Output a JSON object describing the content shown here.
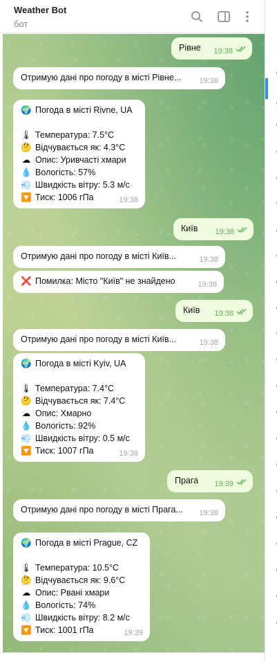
{
  "header": {
    "title": "Weather Bot",
    "subtitle": "бот"
  },
  "messages": {
    "m1": {
      "text": "Рівне",
      "time": "19:38"
    },
    "m2": {
      "text": "Отримую дані про погоду в місті Рівне...",
      "time": "19:38"
    },
    "m3": {
      "title": "Погода в місті Rivne, UA",
      "temp": "Температура: 7.5°C",
      "feels": "Відчувається як: 4.3°C",
      "desc": "Опис: Уривчасті хмари",
      "hum": "Вологість: 57%",
      "wind": "Швидкість вітру: 5.3 м/с",
      "press": "Тиск: 1006 гПа",
      "time": "19:38"
    },
    "m4": {
      "text": "Київ",
      "time": "19:38"
    },
    "m5": {
      "text": "Отримую дані про погоду в місті Київ...",
      "time": "19:38"
    },
    "m6": {
      "text": "Помилка: Місто \"Київ\" не знайдено",
      "time": "19:38"
    },
    "m7": {
      "text": "Київ",
      "time": "19:38"
    },
    "m8": {
      "text": "Отримую дані про погоду в місті Київ...",
      "time": "19:38"
    },
    "m9": {
      "title": "Погода в місті Kyiv, UA",
      "temp": "Температура: 7.4°C",
      "feels": "Відчувається як: 7.4°C",
      "desc": "Опис: Хмарно",
      "hum": "Вологість: 92%",
      "wind": "Швидкість вітру: 0.5 м/с",
      "press": "Тиск: 1007 гПа",
      "time": "19:38"
    },
    "m10": {
      "text": "Прага",
      "time": "19:39"
    },
    "m11": {
      "text": "Отримую дані про погоду в місті Прага...",
      "time": "19:38"
    },
    "m12": {
      "title": "Погода в місті Prague, CZ",
      "temp": "Температура: 10.5°C",
      "feels": "Відчувається як: 9.6°C",
      "desc": "Опис: Рвані хмари",
      "hum": "Вологість: 74%",
      "wind": "Швидкість вітру: 8.2 м/с",
      "press": "Тиск: 1001 гПа",
      "time": "19:39"
    }
  },
  "icons": {
    "globe": "🌍",
    "thermometer": "🌡",
    "feels": "🤔",
    "cloud": "☁",
    "droplet": "💧",
    "wind": "💨",
    "pressure": "🔽",
    "error": "❌"
  },
  "colors": {
    "incoming": "#ffffff",
    "outgoing": "#effdde",
    "check": "#5fb15a",
    "accent": "#e2852b"
  }
}
